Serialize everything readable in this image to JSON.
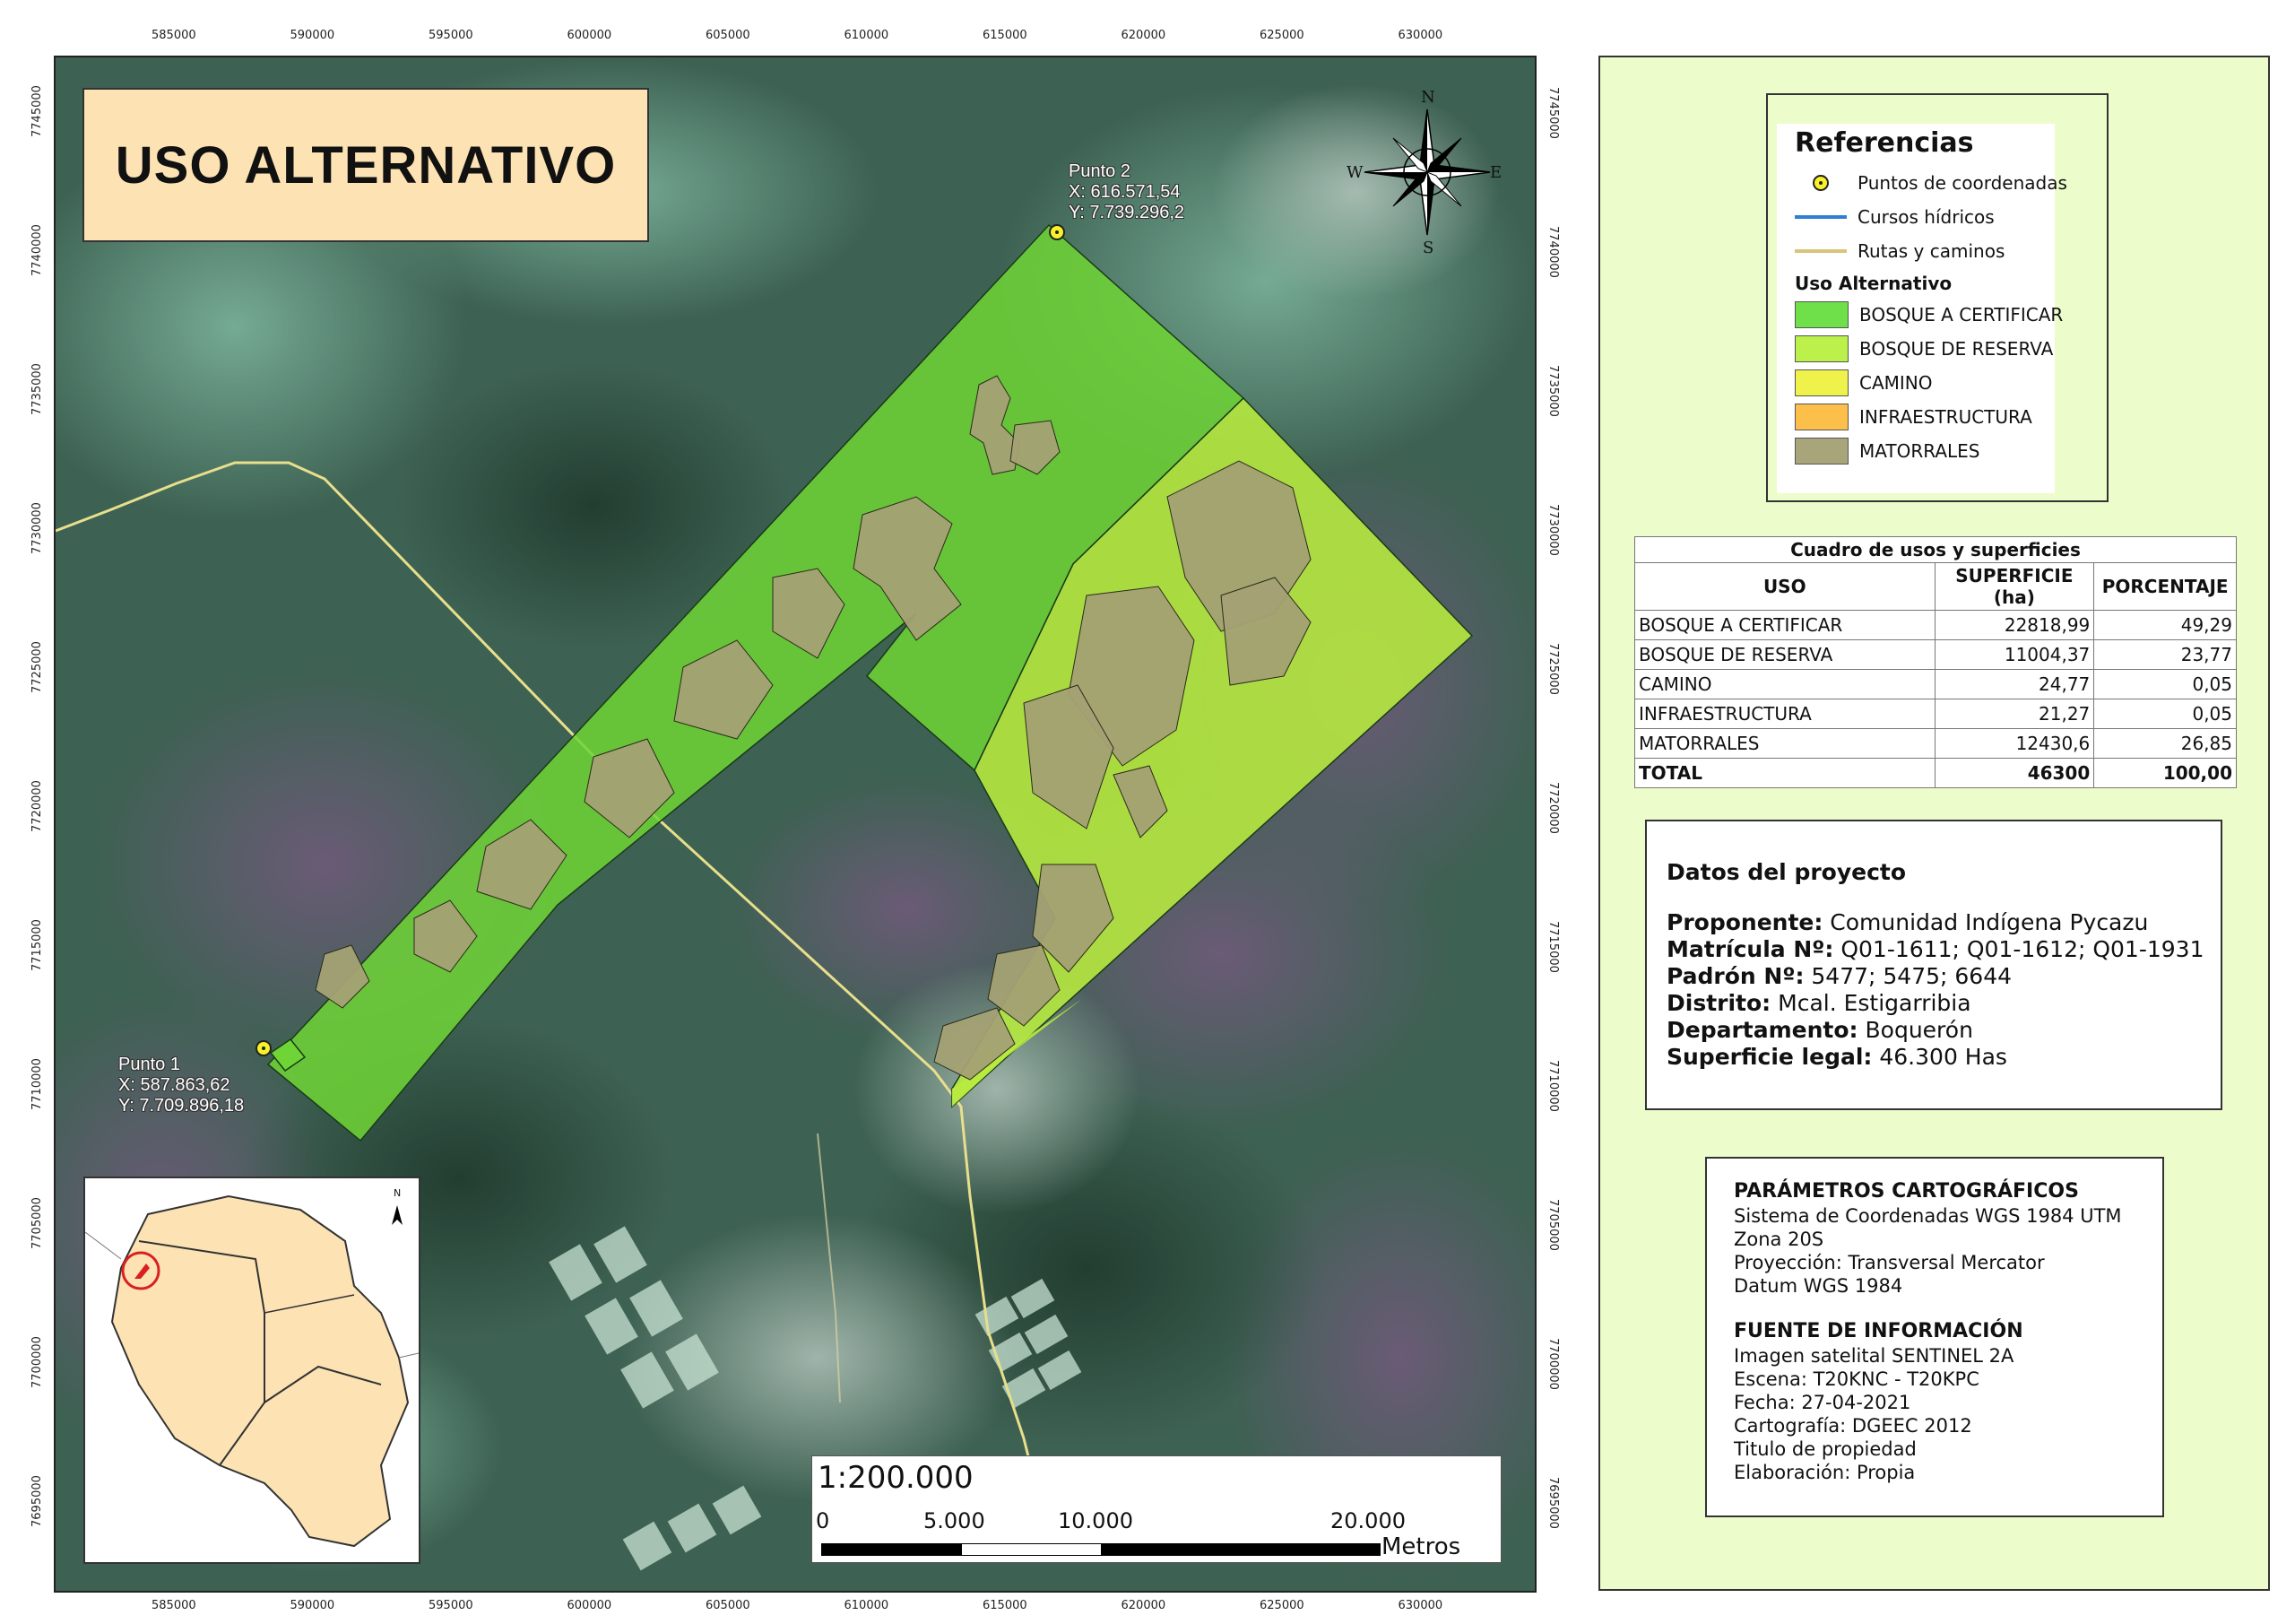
{
  "map": {
    "title": "USO ALTERNATIVO",
    "x_ticks": [
      "585000",
      "590000",
      "595000",
      "600000",
      "605000",
      "610000",
      "615000",
      "620000",
      "625000",
      "630000"
    ],
    "y_ticks": [
      "7745000",
      "7740000",
      "7735000",
      "7730000",
      "7725000",
      "7720000",
      "7715000",
      "7710000",
      "7705000",
      "7700000",
      "7695000"
    ],
    "point1": {
      "name": "Punto 1",
      "x": "X: 587.863,62",
      "y": "Y: 7.709.896,18"
    },
    "point2": {
      "name": "Punto 2",
      "x": "X: 616.571,54",
      "y": "Y: 7.739.296,2"
    },
    "compass": {
      "n": "N",
      "s": "S",
      "e": "E",
      "w": "W"
    },
    "inset_north": "N",
    "colors": {
      "bosque_certificar": "#6fdc3c",
      "bosque_reserva": "#b4ec3e",
      "camino": "#eef24a",
      "infraestructura": "#fcbf4a",
      "matorrales": "#a8a57a",
      "paraguay_fill": "#fde3b4"
    }
  },
  "scale": {
    "ratio": "1:200.000",
    "labels": [
      "0",
      "5.000",
      "10.000",
      "20.000"
    ],
    "unit": "Metros"
  },
  "legend": {
    "title": "Referencias",
    "points": "Puntos de coordenadas",
    "rivers": "Cursos hídricos",
    "roads": "Rutas y caminos",
    "subtitle": "Uso Alternativo",
    "classes": [
      {
        "label": "BOSQUE A CERTIFICAR",
        "color": "#6fe04a"
      },
      {
        "label": "BOSQUE DE RESERVA",
        "color": "#bbf14a"
      },
      {
        "label": "CAMINO",
        "color": "#eef24a"
      },
      {
        "label": "INFRAESTRUCTURA",
        "color": "#fcbf4a"
      },
      {
        "label": "MATORRALES",
        "color": "#a8a57a"
      }
    ]
  },
  "table": {
    "caption": "Cuadro de usos y superficies",
    "headers": [
      "USO",
      "SUPERFICIE (ha)",
      "PORCENTAJE"
    ],
    "rows": [
      [
        "BOSQUE A CERTIFICAR",
        "22818,99",
        "49,29"
      ],
      [
        "BOSQUE DE RESERVA",
        "11004,37",
        "23,77"
      ],
      [
        "CAMINO",
        "24,77",
        "0,05"
      ],
      [
        "INFRAESTRUCTURA",
        "21,27",
        "0,05"
      ],
      [
        "MATORRALES",
        "12430,6",
        "26,85"
      ]
    ],
    "total": [
      "TOTAL",
      "46300",
      "100,00"
    ]
  },
  "datos": {
    "title": "Datos del proyecto",
    "lines": [
      {
        "k": "Proponente:",
        "v": " Comunidad Indígena Pycazu"
      },
      {
        "k": "Matrícula Nº:",
        "v": " Q01-1611; Q01-1612; Q01-1931"
      },
      {
        "k": "Padrón Nº:",
        "v": " 5477; 5475; 6644"
      },
      {
        "k": "Distrito:",
        "v": " Mcal. Estigarribia"
      },
      {
        "k": "Departamento:",
        "v": " Boquerón"
      },
      {
        "k": "Superficie legal:",
        "v": " 46.300 Has"
      }
    ]
  },
  "params": {
    "title1": "PARÁMETROS CARTOGRÁFICOS",
    "lines1": [
      "Sistema de Coordenadas WGS 1984 UTM",
      "Zona 20S",
      "Proyección: Transversal Mercator",
      "Datum WGS 1984"
    ],
    "title2": "FUENTE DE INFORMACIÓN",
    "lines2": [
      "Imagen satelital SENTINEL 2A",
      "Escena: T20KNC - T20KPC",
      "Fecha: 27-04-2021",
      "Cartografía: DGEEC 2012",
      "Titulo de propiedad",
      "Elaboración: Propia"
    ]
  }
}
